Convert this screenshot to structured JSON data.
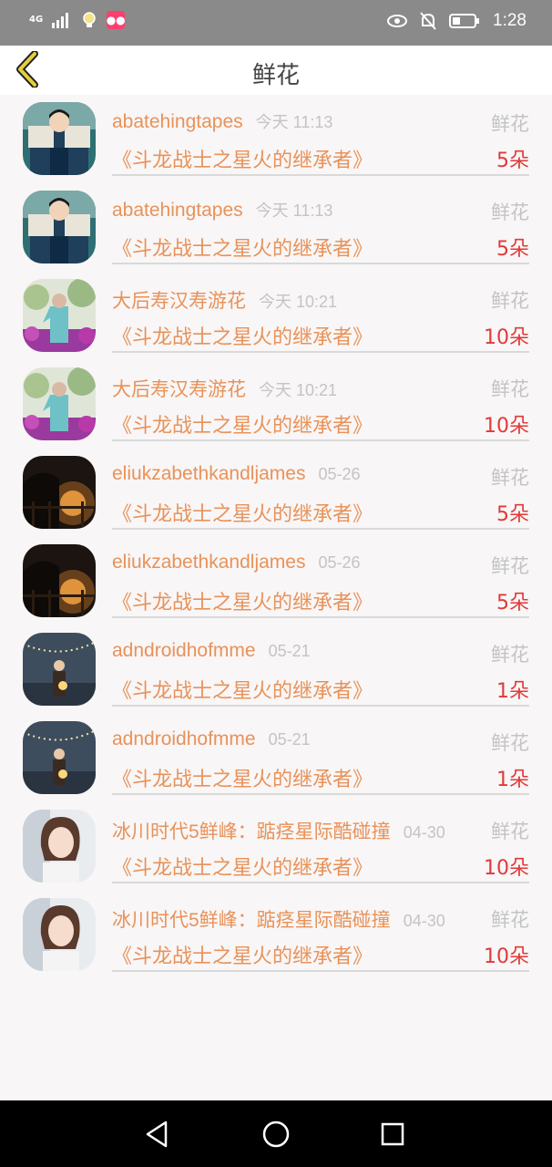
{
  "status_bar": {
    "network": "4G",
    "time": "1:28"
  },
  "header": {
    "title": "鲜花"
  },
  "items": [
    {
      "name": "abatehingtapes",
      "time": "今天 11:13",
      "label": "鲜花",
      "book": "《斗龙战士之星火的继承者》",
      "count": "5朵",
      "avatar_theme": "boy-reading"
    },
    {
      "name": "abatehingtapes",
      "time": "今天 11:13",
      "label": "鲜花",
      "book": "《斗龙战士之星火的继承者》",
      "count": "5朵",
      "avatar_theme": "boy-reading"
    },
    {
      "name": "大后寿汉寿游花",
      "time": "今天 10:21",
      "label": "鲜花",
      "book": "《斗龙战士之星火的继承者》",
      "count": "10朵",
      "avatar_theme": "girl-flowers"
    },
    {
      "name": "大后寿汉寿游花",
      "time": "今天 10:21",
      "label": "鲜花",
      "book": "《斗龙战士之星火的继承者》",
      "count": "10朵",
      "avatar_theme": "girl-flowers"
    },
    {
      "name": "eliukzabethkandljames",
      "time": "05-26",
      "label": "鲜花",
      "book": "《斗龙战士之星火的继承者》",
      "count": "5朵",
      "avatar_theme": "sunset-fence"
    },
    {
      "name": "eliukzabethkandljames",
      "time": "05-26",
      "label": "鲜花",
      "book": "《斗龙战士之星火的继承者》",
      "count": "5朵",
      "avatar_theme": "sunset-fence"
    },
    {
      "name": "adndroidhofmme",
      "time": "05-21",
      "label": "鲜花",
      "book": "《斗龙战士之星火的继承者》",
      "count": "1朵",
      "avatar_theme": "night-lights"
    },
    {
      "name": "adndroidhofmme",
      "time": "05-21",
      "label": "鲜花",
      "book": "《斗龙战士之星火的继承者》",
      "count": "1朵",
      "avatar_theme": "night-lights"
    },
    {
      "name": "冰川时代5鲜峰：踮痉星际酷碰撞",
      "time": "04-30",
      "label": "鲜花",
      "book": "《斗龙战士之星火的继承者》",
      "count": "10朵",
      "avatar_theme": "girl-portrait"
    },
    {
      "name": "冰川时代5鲜峰：踮痉星际酷碰撞",
      "time": "04-30",
      "label": "鲜花",
      "book": "《斗龙战士之星火的继承者》",
      "count": "10朵",
      "avatar_theme": "girl-portrait"
    }
  ],
  "colors": {
    "accent": "#e8925a",
    "count": "#e03a3a",
    "muted": "#c4c4c4",
    "back_arrow": "#e6cf3c"
  }
}
